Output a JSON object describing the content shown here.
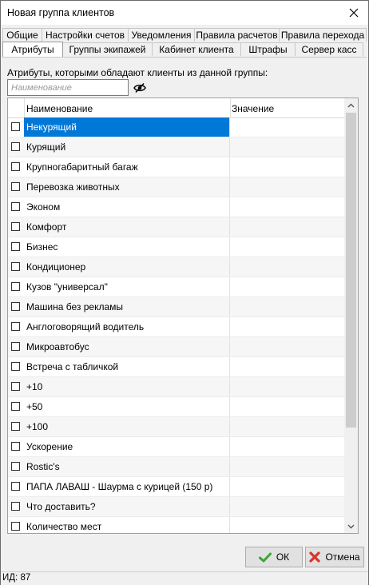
{
  "window": {
    "title": "Новая группа клиентов"
  },
  "tabs_row1": [
    "Общие",
    "Настройки счетов",
    "Уведомления",
    "Правила расчетов",
    "Правила перехода"
  ],
  "tabs_row2": [
    "Атрибуты",
    "Группы экипажей",
    "Кабинет клиента",
    "Штрафы",
    "Сервер касс"
  ],
  "attributes": {
    "description": "Атрибуты, которыми обладают клиенты из данной группы:",
    "search_placeholder": "Наименование",
    "columns": {
      "name": "Наименование",
      "value": "Значение"
    },
    "rows": [
      {
        "name": "Некурящий",
        "value": "",
        "checked": false,
        "selected": true
      },
      {
        "name": "Курящий",
        "value": "",
        "checked": false
      },
      {
        "name": "Крупногабаритный багаж",
        "value": "",
        "checked": false
      },
      {
        "name": "Перевозка животных",
        "value": "",
        "checked": false
      },
      {
        "name": "Эконом",
        "value": "",
        "checked": false
      },
      {
        "name": "Комфорт",
        "value": "",
        "checked": false
      },
      {
        "name": "Бизнес",
        "value": "",
        "checked": false
      },
      {
        "name": "Кондиционер",
        "value": "",
        "checked": false
      },
      {
        "name": "Кузов \"универсал\"",
        "value": "",
        "checked": false
      },
      {
        "name": "Машина без рекламы",
        "value": "",
        "checked": false
      },
      {
        "name": "Англоговорящий водитель",
        "value": "",
        "checked": false
      },
      {
        "name": "Микроавтобус",
        "value": "",
        "checked": false
      },
      {
        "name": "Встреча с табличкой",
        "value": "",
        "checked": false
      },
      {
        "name": "+10",
        "value": "",
        "checked": false
      },
      {
        "name": "+50",
        "value": "",
        "checked": false
      },
      {
        "name": "+100",
        "value": "",
        "checked": false
      },
      {
        "name": "Ускорение",
        "value": "",
        "checked": false
      },
      {
        "name": "Rostic's",
        "value": "",
        "checked": false
      },
      {
        "name": "ПАПА ЛАВАШ - Шаурма с курицей (150 р)",
        "value": "",
        "checked": false
      },
      {
        "name": "Что доставить?",
        "value": "",
        "checked": false
      },
      {
        "name": "Количество мест",
        "value": "",
        "checked": false
      }
    ]
  },
  "buttons": {
    "ok": "ОК",
    "cancel": "Отмена"
  },
  "status": {
    "id": "ИД: 87"
  },
  "colors": {
    "selection": "#0078d7",
    "ok_check": "#3aa53a",
    "cancel_x": "#d9342b"
  }
}
